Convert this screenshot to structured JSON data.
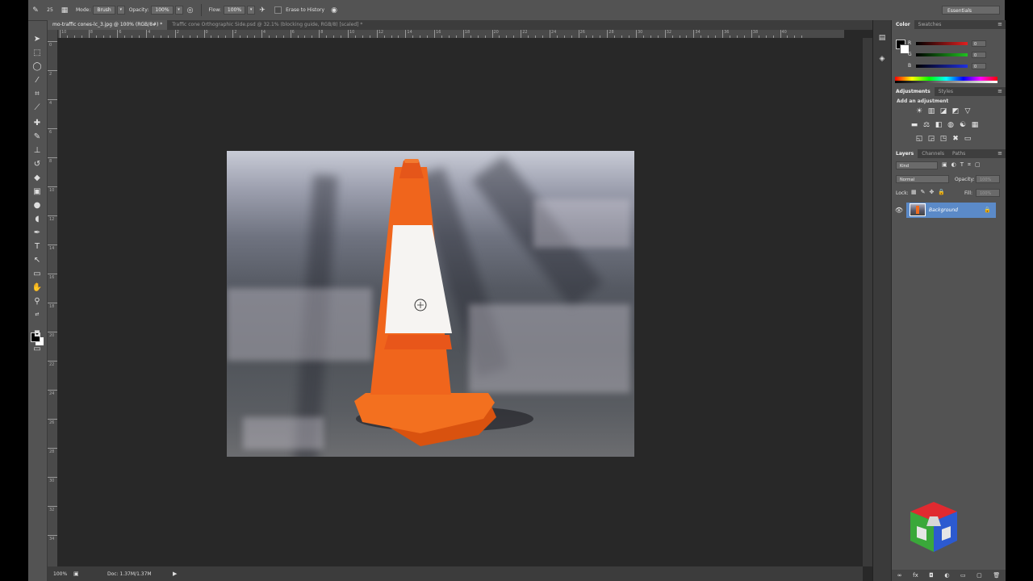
{
  "options_bar": {
    "brush_size": "25",
    "mode_label": "Mode:",
    "mode_value": "Brush",
    "opacity_label": "Opacity:",
    "opacity_value": "100%",
    "flow_label": "Flow:",
    "flow_value": "100%",
    "erase_to_history": "Erase to History",
    "workspace": "Essentials"
  },
  "document_tabs": [
    {
      "label": "mo-traffic cones-lc_3.jpg @ 100% (RGB/8#) *",
      "active": true
    },
    {
      "label": "Traffic cone Orthographic Side.psd @ 32.1% (blocking guide, RGB/8) [scaled] *",
      "active": false
    }
  ],
  "ruler": {
    "h_labels": [
      "10",
      "8",
      "6",
      "4",
      "2",
      "0",
      "2",
      "4",
      "6",
      "8",
      "10",
      "12",
      "14",
      "16",
      "18",
      "20",
      "22",
      "24",
      "26",
      "28",
      "30",
      "32",
      "34",
      "36",
      "38",
      "40"
    ],
    "v_labels": [
      "0",
      "2",
      "4",
      "6",
      "8",
      "10",
      "12",
      "14",
      "16",
      "18",
      "20",
      "22",
      "24",
      "26",
      "28",
      "30",
      "32",
      "34"
    ]
  },
  "status": {
    "zoom": "100%",
    "doc": "Doc: 1.37M/1.37M"
  },
  "color_panel": {
    "tabs": [
      "Color",
      "Swatches"
    ],
    "channels": [
      {
        "label": "R",
        "value": "0",
        "color": "#e02020"
      },
      {
        "label": "G",
        "value": "0",
        "color": "#20c020"
      },
      {
        "label": "B",
        "value": "0",
        "color": "#2030e0"
      }
    ]
  },
  "adjustments_panel": {
    "tabs": [
      "Adjustments",
      "Styles"
    ],
    "heading": "Add an adjustment"
  },
  "layers_panel": {
    "tabs": [
      "Layers",
      "Channels",
      "Paths"
    ],
    "filter": "Kind",
    "blend_mode": "Normal",
    "opacity_label": "Opacity:",
    "opacity_value": "100%",
    "lock_label": "Lock:",
    "fill_label": "Fill:",
    "fill_value": "100%",
    "layer_name": "Background"
  },
  "colors": {
    "cone_orange": "#f0651c",
    "layer_selected": "#5b8ac8"
  }
}
